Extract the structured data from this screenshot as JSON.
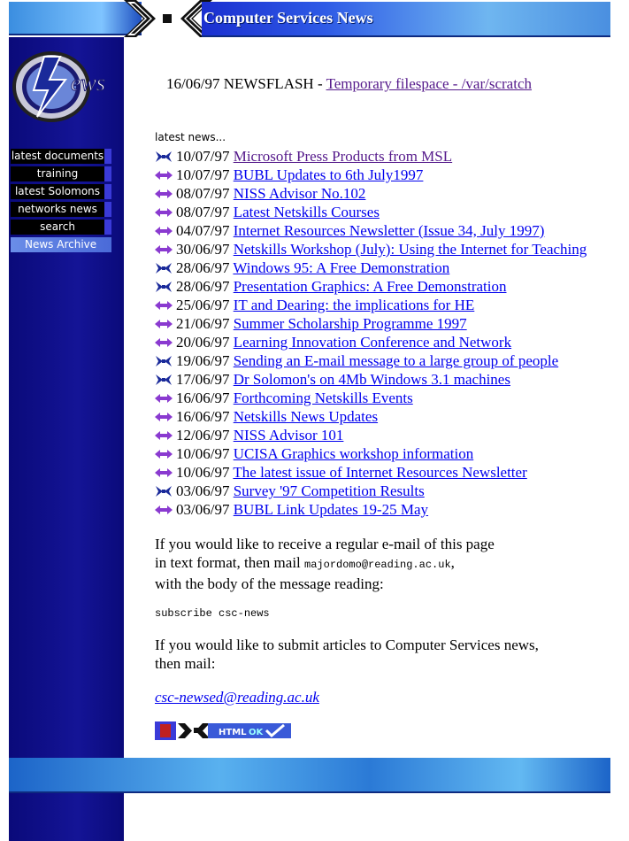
{
  "header": {
    "title": "Computer Services News"
  },
  "logo": {
    "text": "ews"
  },
  "sidebar": {
    "items": [
      {
        "label": "latest documents"
      },
      {
        "label": "training"
      },
      {
        "label": "latest Solomons"
      },
      {
        "label": "networks news"
      },
      {
        "label": "search"
      },
      {
        "label": "News Archive"
      }
    ]
  },
  "flash": {
    "prefix": "16/06/97 NEWSFLASH - ",
    "link": "Temporary filespace - /var/scratch "
  },
  "latest_heading": "latest news...",
  "news": [
    {
      "icon": "bowtie-icon",
      "date": "10/07/97",
      "title": "Microsoft Press Products from MSL",
      "visited": true
    },
    {
      "icon": "double-arrow-icon",
      "date": "10/07/97",
      "title": "BUBL Updates to 6th July1997",
      "visited": false
    },
    {
      "icon": "double-arrow-icon",
      "date": "08/07/97",
      "title": "NISS Advisor No.102",
      "visited": false
    },
    {
      "icon": "double-arrow-icon",
      "date": "08/07/97",
      "title": "Latest Netskills Courses",
      "visited": false
    },
    {
      "icon": "double-arrow-icon",
      "date": "04/07/97",
      "title": "Internet Resources Newsletter (Issue 34, July 1997)",
      "visited": false
    },
    {
      "icon": "double-arrow-icon",
      "date": "30/06/97",
      "title": "Netskills Workshop (July): Using the Internet for Teaching ",
      "visited": false
    },
    {
      "icon": "bowtie-icon",
      "date": "28/06/97",
      "title": "Windows 95: A Free Demonstration",
      "visited": false
    },
    {
      "icon": "bowtie-icon",
      "date": "28/06/97",
      "title": "Presentation Graphics: A Free Demonstration",
      "visited": false
    },
    {
      "icon": "double-arrow-icon",
      "date": "25/06/97",
      "title": "IT and Dearing: the implications for HE",
      "visited": false
    },
    {
      "icon": "double-arrow-icon",
      "date": "21/06/97",
      "title": "Summer Scholarship Programme 1997",
      "visited": false
    },
    {
      "icon": "double-arrow-icon",
      "date": "20/06/97",
      "title": "Learning Innovation Conference and Network",
      "visited": false
    },
    {
      "icon": "bowtie-icon",
      "date": "19/06/97",
      "title": "Sending an E-mail message to a large group of people",
      "visited": false
    },
    {
      "icon": "bowtie-icon",
      "date": "17/06/97",
      "title": "Dr Solomon's on 4Mb Windows 3.1 machines ",
      "visited": false
    },
    {
      "icon": "double-arrow-icon",
      "date": "16/06/97",
      "title": "Forthcoming Netskills Events",
      "visited": false
    },
    {
      "icon": "double-arrow-icon",
      "date": "16/06/97",
      "title": "Netskills News Updates",
      "visited": false
    },
    {
      "icon": "double-arrow-icon",
      "date": "12/06/97",
      "title": "NISS Advisor 101",
      "visited": false
    },
    {
      "icon": "double-arrow-icon",
      "date": "10/06/97",
      "title": "UCISA Graphics workshop information",
      "visited": false
    },
    {
      "icon": "double-arrow-icon",
      "date": "10/06/97",
      "title": "The latest issue of Internet Resources Newsletter",
      "visited": false
    },
    {
      "icon": "bowtie-icon",
      "date": "03/06/97",
      "title": "Survey '97 Competition Results",
      "visited": false
    },
    {
      "icon": "double-arrow-icon",
      "date": "03/06/97",
      "title": "BUBL Link Updates 19-25 May",
      "visited": false
    }
  ],
  "subscribe": {
    "line1": "If you would like to receive a regular e-mail of this page",
    "line2_prefix": "in text format, then mail ",
    "line2_email": "majordomo@reading.ac.uk",
    "line2_suffix": ",",
    "line3": "with the body of the message reading:",
    "command": "subscribe csc-news"
  },
  "submit": {
    "line1": "If you would like to submit articles to Computer Services news,",
    "line2": "then mail:",
    "email": "csc-newsed@reading.ac.uk"
  },
  "badge": {
    "label": "HTML",
    "ok": "OK"
  },
  "colors": {
    "sidebar": "#0a0a8c",
    "link": "#0000ee",
    "visited": "#551a8b",
    "icon_bowtie": "#1a2a9a",
    "icon_arrow": "#8a3ad0"
  }
}
